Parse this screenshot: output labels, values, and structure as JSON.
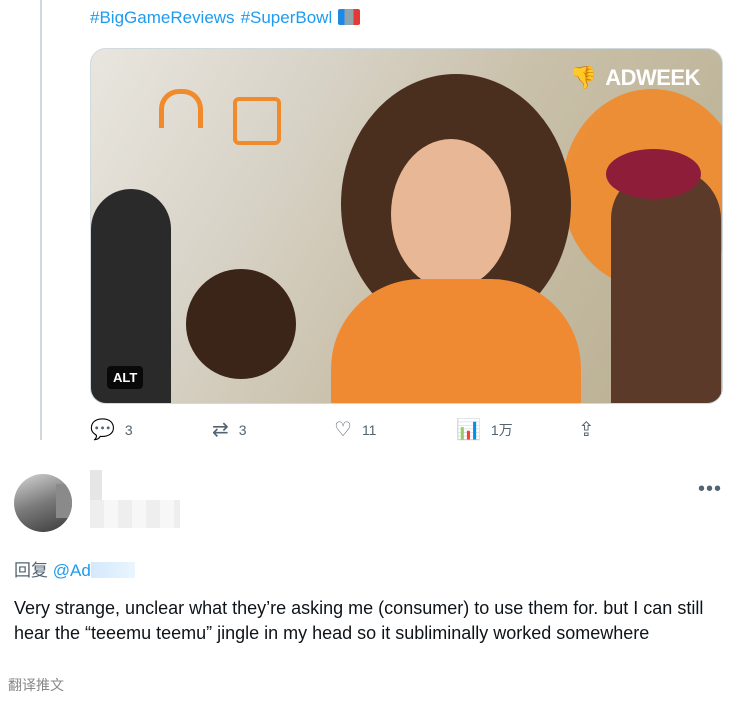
{
  "tweet": {
    "hashtags": [
      "#BigGameReviews",
      "#SuperBowl"
    ],
    "hashtag_emoji_icon": "super-bowl-emoji-icon",
    "media": {
      "brand_watermark": "ADWEEK",
      "brand_icon": "thumbs-down-icon",
      "alt_badge": "ALT"
    },
    "actions": {
      "replies": "3",
      "retweets": "3",
      "likes": "11",
      "views": "1万",
      "icons": [
        "reply-icon",
        "retweet-icon",
        "heart-icon",
        "views-icon",
        "share-icon"
      ]
    }
  },
  "reply": {
    "more_label": "•••",
    "reply_prefix": "回复",
    "reply_handle": "@Ad",
    "text": "Very strange, unclear what they’re asking me (consumer) to use them for. but I can still hear the “teeemu teemu” jingle in my head so it subliminally worked somewhere",
    "translate_label": "翻译推文"
  },
  "colors": {
    "link": "#1d9bf0",
    "muted": "#536471",
    "text": "#0f1419",
    "border": "#cfd9de"
  }
}
